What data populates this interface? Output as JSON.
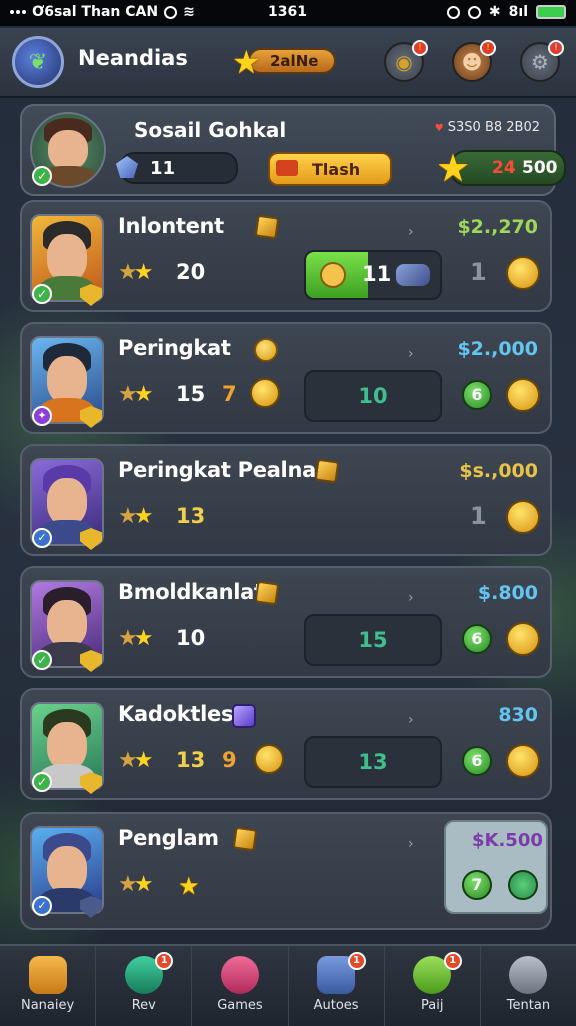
{
  "status_bar": {
    "carrier": "Ơ6sal Than CAN",
    "time": "1361",
    "right_text": "8ıl"
  },
  "header": {
    "app_title": "Neandias",
    "currency_value": "2alNe"
  },
  "profile": {
    "name": "Sosail Gohkal",
    "gem_count": "11",
    "action_label": "Tlash",
    "top_right_value": "S3S0 B8 2B02",
    "score_red": "24",
    "score_white": "500"
  },
  "cards": [
    {
      "name": "Inlontent",
      "count": "20",
      "amount": "$2.,270",
      "amount_color": "#9ed85a",
      "slot_value": "11",
      "right_digit": "1"
    },
    {
      "name": "Peringkat",
      "count": "15",
      "secondary": "7",
      "amount": "$2.,000",
      "amount_color": "#63c5f0",
      "slot_value": "10",
      "right_digit": "6"
    },
    {
      "name": "Peringkat Pealnan",
      "count": "13",
      "amount": "$s.,000",
      "amount_color": "#e9c24a",
      "right_digit": "1"
    },
    {
      "name": "Bmoldkanlat",
      "count": "10",
      "amount": "$.800",
      "amount_color": "#63c5f0",
      "slot_value": "15",
      "right_digit": "6"
    },
    {
      "name": "Kadoktles",
      "count": "13",
      "secondary": "9",
      "amount": "830",
      "amount_color": "#63c5f0",
      "slot_value": "13",
      "right_digit": "6"
    },
    {
      "name": "Penglam",
      "amount": "$K.500",
      "right_left_digit": "7"
    }
  ],
  "nav": [
    {
      "label": "Nanaiey",
      "icon": "home-icon",
      "color": "#e9a23a"
    },
    {
      "label": "Rev",
      "icon": "refresh-icon",
      "color": "#2fb38c",
      "badge": "1"
    },
    {
      "label": "Games",
      "icon": "heart-gem-icon",
      "color": "#e04a7a"
    },
    {
      "label": "Autoes",
      "icon": "box-icon",
      "color": "#5a7fd0",
      "badge": "1"
    },
    {
      "label": "Paij",
      "icon": "pay-icon",
      "color": "#7ad04a",
      "badge": "1"
    },
    {
      "label": "Tentan",
      "icon": "profile-icon",
      "color": "#9aa3ae"
    }
  ]
}
